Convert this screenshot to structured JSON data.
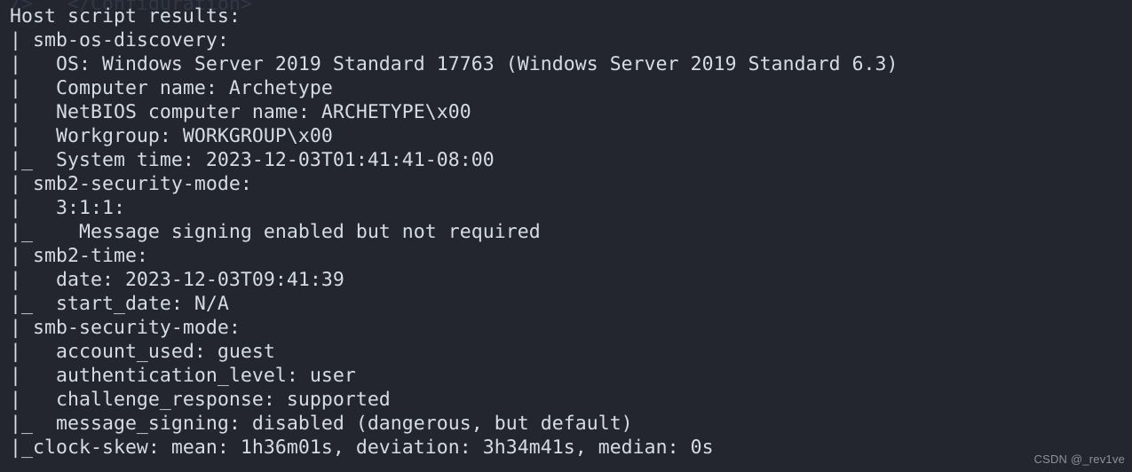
{
  "terminal": {
    "background_color": "#24262f",
    "foreground_color": "#d6dbe4",
    "ghost_color": "#34384a",
    "scrollback_partial_line": "/>   </Configuration>",
    "lines": [
      "Host script results:",
      "| smb-os-discovery: ",
      "|   OS: Windows Server 2019 Standard 17763 (Windows Server 2019 Standard 6.3)",
      "|   Computer name: Archetype",
      "|   NetBIOS computer name: ARCHETYPE\\x00",
      "|   Workgroup: WORKGROUP\\x00",
      "|_  System time: 2023-12-03T01:41:41-08:00",
      "| smb2-security-mode: ",
      "|   3:1:1: ",
      "|_    Message signing enabled but not required",
      "| smb2-time: ",
      "|   date: 2023-12-03T09:41:39",
      "|_  start_date: N/A",
      "| smb-security-mode: ",
      "|   account_used: guest",
      "|   authentication_level: user",
      "|   challenge_response: supported",
      "|_  message_signing: disabled (dangerous, but default)",
      "|_clock-skew: mean: 1h36m01s, deviation: 3h34m41s, median: 0s"
    ]
  },
  "watermark": {
    "text": "CSDN @_rev1ve",
    "color": "#8d9099"
  }
}
